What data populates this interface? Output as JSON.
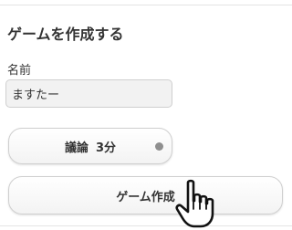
{
  "section": {
    "title": "ゲームを作成する"
  },
  "form": {
    "name_label": "名前",
    "name_value": "ますたー",
    "discussion_option": {
      "label": "議論",
      "minutes": "3分"
    },
    "create_button_label": "ゲーム作成"
  },
  "cursor": {
    "icon": "hand-pointer-icon"
  }
}
